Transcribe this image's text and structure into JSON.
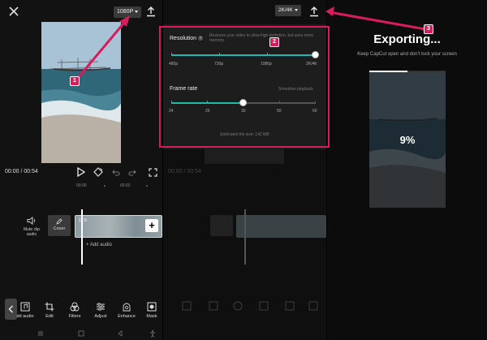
{
  "colors": {
    "accent": "#d61e5c",
    "slider_fill": "#1fb9b3",
    "background": "#121212"
  },
  "editor": {
    "resolution_pill": "1080P",
    "time_current": "00:00",
    "time_separator": " / ",
    "time_total": "00:54",
    "ruler": [
      "00:00",
      "00:02"
    ],
    "mute_label": "Mute clip audio",
    "cover_label": "Cover",
    "clip_duration": "12.5",
    "add_audio": "+ Add audio",
    "tools": [
      {
        "label": "dd audio",
        "icon": "music-icon"
      },
      {
        "label": "Edit",
        "icon": "crop-icon"
      },
      {
        "label": "Filters",
        "icon": "filters-icon"
      },
      {
        "label": "Adjust",
        "icon": "adjust-icon"
      },
      {
        "label": "Enhance",
        "icon": "enhance-icon"
      },
      {
        "label": "Mask",
        "icon": "mask-icon"
      }
    ]
  },
  "export_settings": {
    "resolution_pill": "2K/4K",
    "resolution_title": "Resolution",
    "resolution_note": "Restores your video to ultra-high definition, but uses more memory.",
    "resolution_options": [
      "480p",
      "720p",
      "1080p",
      "2K/4K"
    ],
    "resolution_selected_index": 3,
    "frame_rate_title": "Frame rate",
    "frame_rate_note": "Smoother playback",
    "frame_rate_options": [
      "24",
      "25",
      "30",
      "50",
      "60"
    ],
    "frame_rate_selected_index": 2,
    "file_size": "Estimated file size: 142 MB",
    "dim_time": "00:00 / 00:54"
  },
  "exporting": {
    "title": "Exporting...",
    "subtitle": "Keep CapCut open and don't lock your screen",
    "percent": "9%",
    "progress_fraction": 0.09
  },
  "callouts": [
    "1",
    "2",
    "3"
  ]
}
